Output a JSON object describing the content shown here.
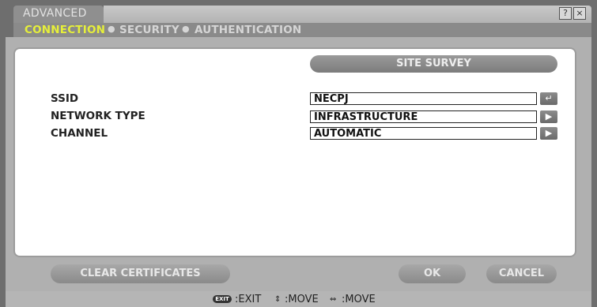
{
  "window": {
    "tab_title": "ADVANCED"
  },
  "title_buttons": {
    "help": "?",
    "close": "×"
  },
  "nav": {
    "items": [
      "CONNECTION",
      "SECURITY",
      "AUTHENTICATION"
    ],
    "active": "CONNECTION",
    "active_color": "#e6ef3a"
  },
  "site_survey": {
    "label": "SITE SURVEY"
  },
  "fields": {
    "ssid": {
      "label": "SSID",
      "value": "NECPJ",
      "button_icon": "enter-icon"
    },
    "network_type": {
      "label": "NETWORK TYPE",
      "value": "INFRASTRUCTURE",
      "button_icon": "arrow-right-icon"
    },
    "channel": {
      "label": "CHANNEL",
      "value": "AUTOMATIC",
      "button_icon": "arrow-right-icon"
    }
  },
  "buttons": {
    "clear_certificates": "CLEAR CERTIFICATES",
    "ok": "OK",
    "cancel": "CANCEL"
  },
  "footer": {
    "exit_key": "EXIT",
    "exit_label": ":EXIT",
    "move_v_label": ":MOVE",
    "move_h_label": ":MOVE"
  }
}
